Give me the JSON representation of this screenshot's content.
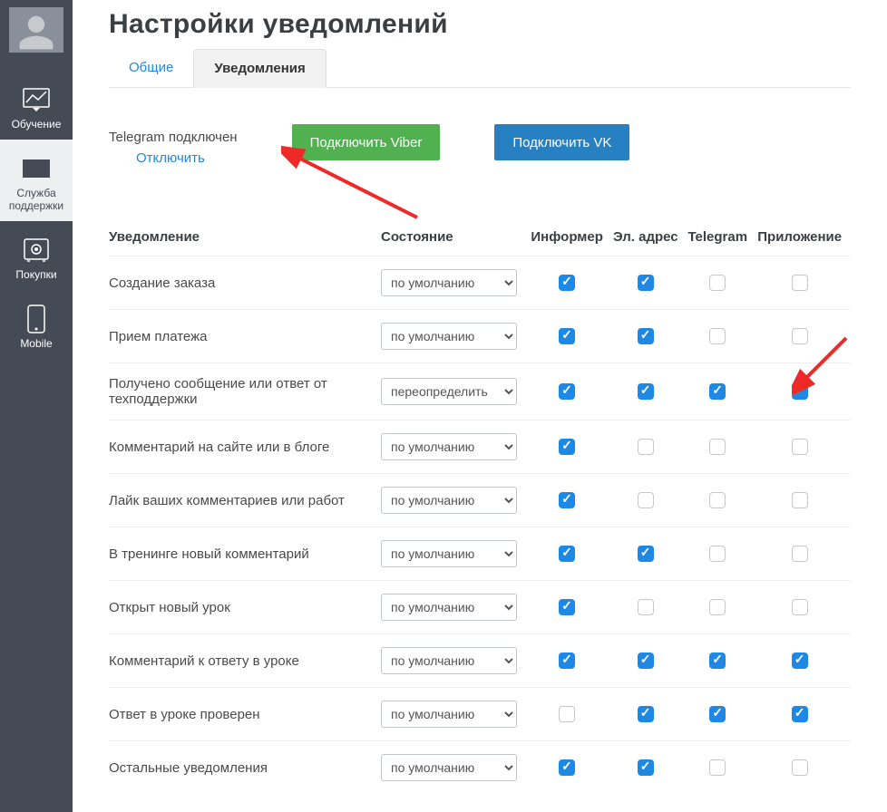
{
  "sidebar": {
    "items": [
      {
        "label": "Обучение"
      },
      {
        "label": "Служба поддержки"
      },
      {
        "label": "Покупки"
      },
      {
        "label": "Mobile"
      }
    ]
  },
  "page": {
    "title": "Настройки уведомлений",
    "tabs": {
      "general": "Общие",
      "notifications": "Уведомления"
    }
  },
  "connect": {
    "tg_status": "Telegram подключен",
    "tg_disconnect": "Отключить",
    "viber_btn": "Подключить Viber",
    "vk_btn": "Подключить VK"
  },
  "table": {
    "headers": {
      "notification": "Уведомление",
      "state": "Состояние",
      "informer": "Информер",
      "email": "Эл. адрес",
      "telegram": "Telegram",
      "app": "Приложение"
    },
    "options": {
      "default": "по умолчанию",
      "override": "переопределить"
    },
    "rows": [
      {
        "label": "Создание заказа",
        "state": "default",
        "cells": [
          {
            "t": "cd"
          },
          {
            "t": "cd"
          },
          {
            "t": "e"
          },
          {
            "t": "e"
          }
        ]
      },
      {
        "label": "Прием платежа",
        "state": "default",
        "cells": [
          {
            "t": "cd"
          },
          {
            "t": "cd"
          },
          {
            "t": "e"
          },
          {
            "t": "e"
          }
        ]
      },
      {
        "label": "Получено сообщение или ответ от техподдержки",
        "state": "override",
        "cells": [
          {
            "t": "c"
          },
          {
            "t": "c"
          },
          {
            "t": "c"
          },
          {
            "t": "c"
          }
        ]
      },
      {
        "label": "Комментарий на сайте или в блоге",
        "state": "default",
        "cells": [
          {
            "t": "cd"
          },
          {
            "t": "e"
          },
          {
            "t": "e"
          },
          {
            "t": "e"
          }
        ]
      },
      {
        "label": "Лайк ваших комментариев или работ",
        "state": "default",
        "cells": [
          {
            "t": "cd"
          },
          {
            "t": "e"
          },
          {
            "t": "e"
          },
          {
            "t": "e"
          }
        ]
      },
      {
        "label": "В тренинге новый комментарий",
        "state": "default",
        "cells": [
          {
            "t": "cd"
          },
          {
            "t": "cd"
          },
          {
            "t": "e"
          },
          {
            "t": "e"
          }
        ]
      },
      {
        "label": "Открыт новый урок",
        "state": "default",
        "cells": [
          {
            "t": "cd"
          },
          {
            "t": "e"
          },
          {
            "t": "e"
          },
          {
            "t": "e"
          }
        ]
      },
      {
        "label": "Комментарий к ответу в уроке",
        "state": "default",
        "cells": [
          {
            "t": "cd"
          },
          {
            "t": "cd"
          },
          {
            "t": "cd"
          },
          {
            "t": "cd"
          }
        ]
      },
      {
        "label": "Ответ в уроке проверен",
        "state": "default",
        "cells": [
          {
            "t": "e"
          },
          {
            "t": "cd"
          },
          {
            "t": "cd"
          },
          {
            "t": "cd"
          }
        ]
      },
      {
        "label": "Остальные уведомления",
        "state": "default",
        "cells": [
          {
            "t": "cd"
          },
          {
            "t": "cd"
          },
          {
            "t": "e"
          },
          {
            "t": "e"
          }
        ]
      }
    ]
  }
}
